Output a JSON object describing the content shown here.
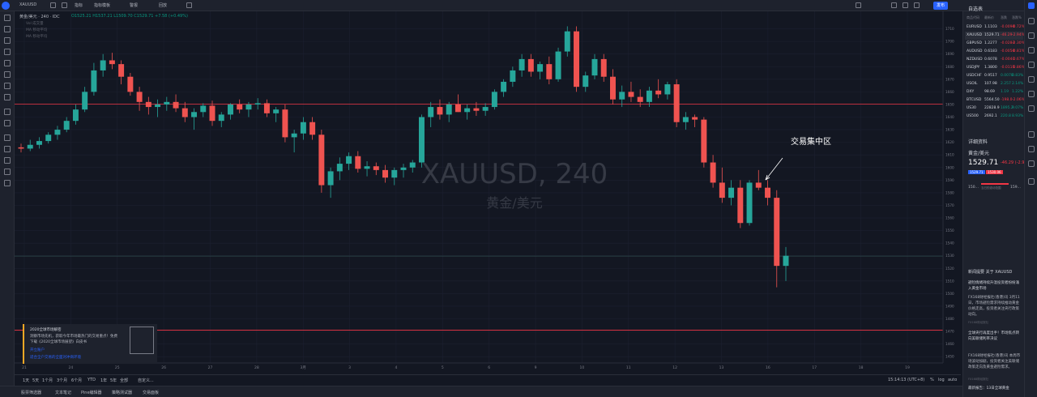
{
  "header": {
    "symbol": "XAUUSD",
    "items": [
      "指标",
      "指标模板",
      "警报",
      "回放"
    ],
    "publish": "发布",
    "search_placeholder": "搜索"
  },
  "legend": {
    "title": "黄金/美元 · 240 · IDC",
    "ohlc": "O1525.21 H1537.21 L1509.70 C1529.71 +7.58 (+0.49%)",
    "sub_rows": [
      "Vol 成交量",
      "MA 移动平均",
      "MA 移动平均"
    ]
  },
  "watermark": {
    "symbol": "XAUUSD, 240",
    "name": "黄金/美元"
  },
  "annotation": {
    "text": "交易集中区"
  },
  "ad": {
    "title": "2020全球市场解密",
    "line1": "洞察市场先机，获取今年市场最热门的交易重点！免费",
    "line2": "下载《2020全球市场展望》白皮书",
    "line3": "开立账户",
    "line4": "适合全户交易的全面对冲商环境"
  },
  "bottom_bar": {
    "ranges": [
      "1天",
      "5天",
      "1个月",
      "3个月",
      "6个月",
      "YTD",
      "1年",
      "5年",
      "全部",
      "自定义..."
    ],
    "time": "15:14:13 (UTC+8)",
    "toggles": [
      "%",
      "log",
      "auto"
    ]
  },
  "status_bar": {
    "tabs": [
      "股票筛选器",
      "文本笔记",
      "Pine编辑器",
      "策略测试器",
      "交易面板"
    ]
  },
  "watchlist": {
    "title": "自选表",
    "header": [
      "商品代码",
      "最新价",
      "涨跌",
      "涨跌%"
    ],
    "rows": [
      {
        "symbol": "EURUSD",
        "last": "1.1103",
        "chg": "-0.0090",
        "pct": "-0.72%",
        "color": "#f23645"
      },
      {
        "symbol": "XAUUSD",
        "last": "1529.71",
        "chg": "-46.29",
        "pct": "-2.94%",
        "color": "#f23645"
      },
      {
        "symbol": "GBPUSD",
        "last": "1.2277",
        "chg": "-0.0283",
        "pct": "-2.30%",
        "color": "#f23645"
      },
      {
        "symbol": "AUDUSD",
        "last": "0.6183",
        "chg": "-0.0050",
        "pct": "-0.81%",
        "color": "#f23645"
      },
      {
        "symbol": "NZDUSD",
        "last": "0.6078",
        "chg": "-0.0041",
        "pct": "-0.67%",
        "color": "#f23645"
      },
      {
        "symbol": "USDJPY",
        "last": "1.3800",
        "chg": "-0.0115",
        "pct": "-0.86%",
        "color": "#f23645"
      },
      {
        "symbol": "USDCHF",
        "last": "0.9517",
        "chg": "0.0078",
        "pct": "0.83%",
        "color": "#089981"
      },
      {
        "symbol": "USOIL",
        "last": "107.98",
        "chg": "2.257",
        "pct": "2.14%",
        "color": "#089981"
      },
      {
        "symbol": "DXY",
        "last": "98.69",
        "chg": "1.19",
        "pct": "1.22%",
        "color": "#089981"
      },
      {
        "symbol": "BTCUSD",
        "last": "5564.50",
        "chg": "-198.0",
        "pct": "-2.06%",
        "color": "#f23645"
      },
      {
        "symbol": "US30",
        "last": "22828.9",
        "chg": "1895.2",
        "pct": "9.07%",
        "color": "#089981"
      },
      {
        "symbol": "US500",
        "last": "2692.1",
        "chg": "220.8",
        "pct": "8.93%",
        "color": "#089981"
      }
    ]
  },
  "details": {
    "title": "详细资料",
    "name": "黄金/美元",
    "price": "1529.71",
    "change": "-46.29 (-2.94%)",
    "bid": "1529.71",
    "ask": "1530.06",
    "range_low": "150...",
    "range_label": "当日的波动范围",
    "range_high": "159..."
  },
  "news": {
    "header": "新闻提要 关于 XAUUSD",
    "item1_title": "避险情绪持续升温投资者纷纷涌入黄金市场",
    "item1_text": "FX168财经报社(香港)讯 3月11日，市场避险需求持续推动黄金价格走高，投资者关注央行政策动向。",
    "item1_meta": "FX168财经报社",
    "item2_title": "全球央行再度出手！市场焦点转向美联储利率决议",
    "item2_text": "FX168财经报社(香港)讯 本周市场波动加剧，投资者关注美联储政策走向及黄金避险需求。",
    "item2_meta": "FX168财经报社",
    "item3_title": "最新报告：13日全球黄金"
  },
  "chart_data": {
    "type": "candlestick",
    "ylim": [
      1445,
      1720
    ],
    "yticks": [
      1450,
      1460,
      1470,
      1480,
      1490,
      1500,
      1510,
      1520,
      1530,
      1540,
      1550,
      1560,
      1570,
      1580,
      1590,
      1600,
      1610,
      1620,
      1630,
      1640,
      1650,
      1660,
      1670,
      1680,
      1690,
      1700,
      1710
    ],
    "xlabels": [
      "21",
      "24",
      "25",
      "26",
      "27",
      "28",
      "3月",
      "3",
      "4",
      "5",
      "6",
      "9",
      "10",
      "11",
      "12",
      "13",
      "16",
      "17",
      "18",
      "19"
    ],
    "horizontal_lines": [
      {
        "price": 1650.3,
        "color": "#f23645",
        "label": "1650.30"
      },
      {
        "price": 1529.71,
        "color": "#2e4a4a",
        "label": "1529.71"
      },
      {
        "price": 1470.97,
        "color": "#f23645",
        "label": "1470.97"
      }
    ],
    "candles": [
      [
        1616,
        1619,
        1612,
        1615
      ],
      [
        1615,
        1622,
        1613,
        1618
      ],
      [
        1618,
        1624,
        1615,
        1621
      ],
      [
        1621,
        1628,
        1619,
        1626
      ],
      [
        1626,
        1633,
        1622,
        1630
      ],
      [
        1630,
        1640,
        1628,
        1637
      ],
      [
        1637,
        1650,
        1634,
        1646
      ],
      [
        1646,
        1664,
        1644,
        1660
      ],
      [
        1660,
        1683,
        1657,
        1677
      ],
      [
        1677,
        1690,
        1672,
        1685
      ],
      [
        1685,
        1691,
        1678,
        1682
      ],
      [
        1682,
        1685,
        1666,
        1672
      ],
      [
        1672,
        1675,
        1657,
        1660
      ],
      [
        1660,
        1664,
        1645,
        1652
      ],
      [
        1652,
        1656,
        1642,
        1648
      ],
      [
        1648,
        1654,
        1640,
        1650
      ],
      [
        1650,
        1656,
        1645,
        1652
      ],
      [
        1652,
        1658,
        1644,
        1647
      ],
      [
        1647,
        1652,
        1636,
        1640
      ],
      [
        1640,
        1647,
        1630,
        1644
      ],
      [
        1644,
        1651,
        1640,
        1649
      ],
      [
        1649,
        1653,
        1633,
        1637
      ],
      [
        1637,
        1644,
        1632,
        1642
      ],
      [
        1642,
        1651,
        1638,
        1650
      ],
      [
        1650,
        1654,
        1643,
        1646
      ],
      [
        1646,
        1652,
        1640,
        1650
      ],
      [
        1650,
        1655,
        1646,
        1651
      ],
      [
        1651,
        1654,
        1640,
        1643
      ],
      [
        1643,
        1648,
        1636,
        1646
      ],
      [
        1646,
        1650,
        1620,
        1624
      ],
      [
        1624,
        1630,
        1612,
        1627
      ],
      [
        1627,
        1640,
        1622,
        1636
      ],
      [
        1636,
        1640,
        1622,
        1626
      ],
      [
        1626,
        1630,
        1580,
        1586
      ],
      [
        1586,
        1600,
        1576,
        1597
      ],
      [
        1597,
        1608,
        1590,
        1603
      ],
      [
        1603,
        1612,
        1598,
        1609
      ],
      [
        1609,
        1613,
        1596,
        1599
      ],
      [
        1599,
        1605,
        1593,
        1601
      ],
      [
        1601,
        1604,
        1594,
        1598
      ],
      [
        1598,
        1602,
        1588,
        1592
      ],
      [
        1592,
        1600,
        1586,
        1598
      ],
      [
        1598,
        1603,
        1592,
        1600
      ],
      [
        1600,
        1606,
        1596,
        1604
      ],
      [
        1604,
        1642,
        1600,
        1640
      ],
      [
        1640,
        1652,
        1632,
        1648
      ],
      [
        1648,
        1654,
        1638,
        1642
      ],
      [
        1642,
        1652,
        1636,
        1650
      ],
      [
        1650,
        1658,
        1644,
        1644
      ],
      [
        1644,
        1650,
        1638,
        1647
      ],
      [
        1647,
        1652,
        1641,
        1645
      ],
      [
        1645,
        1651,
        1641,
        1648
      ],
      [
        1648,
        1662,
        1646,
        1660
      ],
      [
        1660,
        1670,
        1656,
        1668
      ],
      [
        1668,
        1680,
        1664,
        1677
      ],
      [
        1677,
        1690,
        1672,
        1686
      ],
      [
        1686,
        1690,
        1672,
        1676
      ],
      [
        1676,
        1684,
        1670,
        1682
      ],
      [
        1682,
        1688,
        1666,
        1670
      ],
      [
        1670,
        1695,
        1668,
        1692
      ],
      [
        1692,
        1712,
        1688,
        1708
      ],
      [
        1708,
        1712,
        1660,
        1664
      ],
      [
        1664,
        1676,
        1660,
        1673
      ],
      [
        1673,
        1690,
        1670,
        1686
      ],
      [
        1686,
        1690,
        1668,
        1672
      ],
      [
        1672,
        1678,
        1650,
        1654
      ],
      [
        1654,
        1665,
        1648,
        1660
      ],
      [
        1660,
        1668,
        1652,
        1656
      ],
      [
        1656,
        1662,
        1648,
        1652
      ],
      [
        1652,
        1664,
        1648,
        1661
      ],
      [
        1661,
        1670,
        1655,
        1658
      ],
      [
        1658,
        1668,
        1654,
        1666
      ],
      [
        1666,
        1670,
        1632,
        1636
      ],
      [
        1636,
        1644,
        1630,
        1640
      ],
      [
        1640,
        1642,
        1632,
        1638
      ],
      [
        1638,
        1640,
        1600,
        1604
      ],
      [
        1604,
        1610,
        1584,
        1588
      ],
      [
        1588,
        1600,
        1572,
        1576
      ],
      [
        1576,
        1590,
        1570,
        1584
      ],
      [
        1584,
        1590,
        1552,
        1556
      ],
      [
        1556,
        1590,
        1554,
        1588
      ],
      [
        1588,
        1598,
        1582,
        1584
      ],
      [
        1584,
        1590,
        1570,
        1576
      ],
      [
        1576,
        1582,
        1505,
        1522
      ],
      [
        1522,
        1537,
        1510,
        1530
      ]
    ]
  }
}
